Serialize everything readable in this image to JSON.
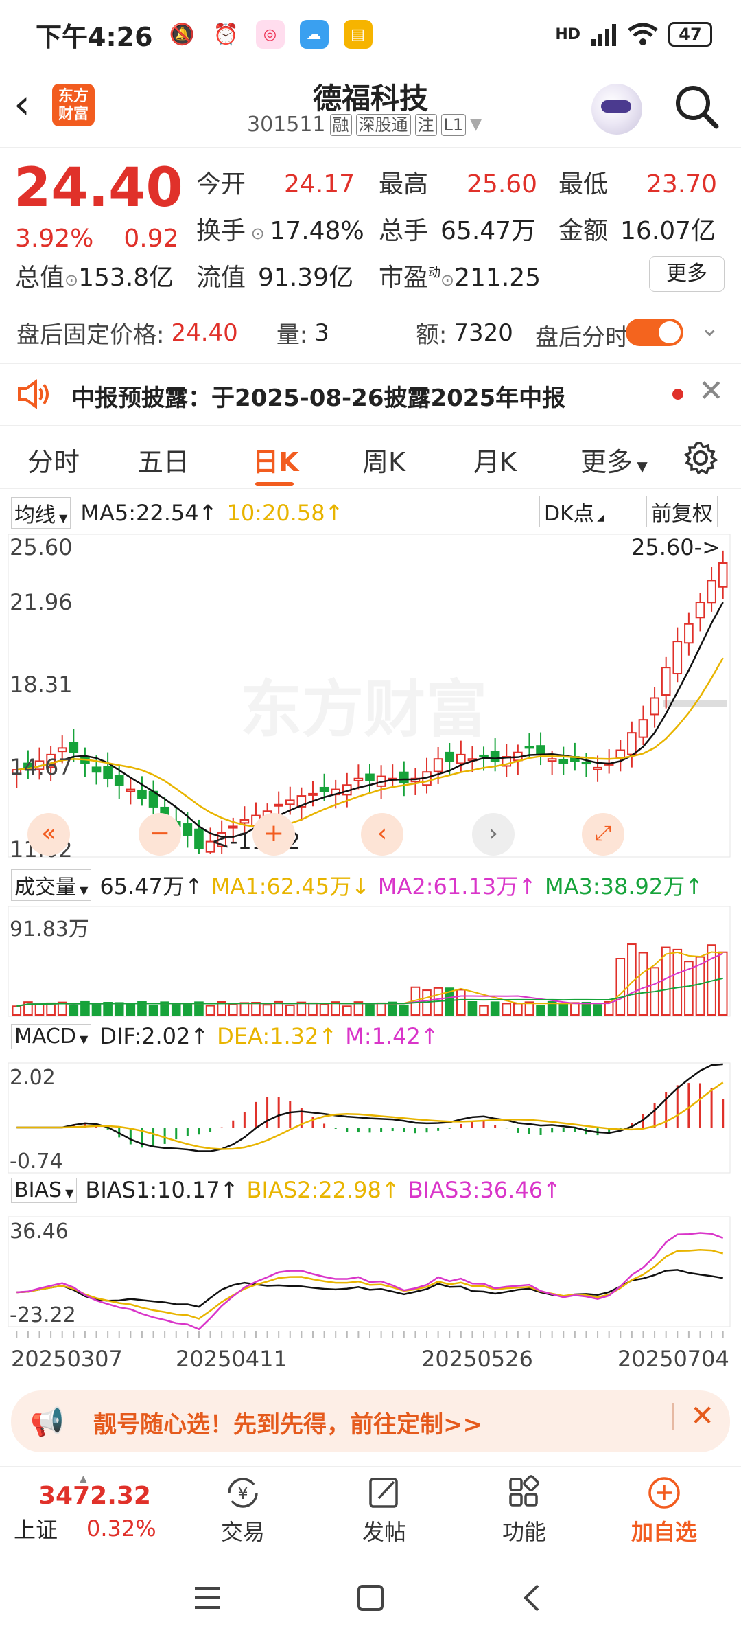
{
  "status": {
    "time": "下午4:26",
    "signal": "HD",
    "battery": "47"
  },
  "header": {
    "title": "德福科技",
    "code": "301511",
    "tags": [
      "融",
      "深股通",
      "注",
      "L1"
    ],
    "logo": "东方\n财富"
  },
  "quote": {
    "price": "24.40",
    "change_pct": "3.92%",
    "change": "0.92",
    "open_k": "今开",
    "open_v": "24.17",
    "high_k": "最高",
    "high_v": "25.60",
    "low_k": "最低",
    "low_v": "23.70",
    "turnover_k": "换手",
    "turnover_v": "17.48%",
    "vol_k": "总手",
    "vol_v": "65.47万",
    "amt_k": "金额",
    "amt_v": "16.07亿",
    "mcap_k": "总值",
    "mcap_v": "153.8亿",
    "float_k": "流值",
    "float_v": "91.39亿",
    "pe_k": "市盈",
    "pe_sup": "动",
    "pe_v": "211.25",
    "more_label": "更多"
  },
  "afterhours": {
    "label": "盘后固定价格:",
    "price": "24.40",
    "vol_label": "量:",
    "vol": "3",
    "amt_label": "额:",
    "amt": "7320",
    "toggle_label": "盘后分时"
  },
  "notice": {
    "text": "中报预披露：于2025-08-26披露2025年中报"
  },
  "tabs": [
    "分时",
    "五日",
    "日K",
    "周K",
    "月K",
    "更多"
  ],
  "kline": {
    "ma_selector": "均线",
    "ma5": "MA5:22.54↑",
    "ma10": "10:20.58↑",
    "dk_label": "DK点",
    "adjust_label": "前复权",
    "axis_labels": [
      "25.60",
      "21.96",
      "18.31",
      "14.67",
      "11.02"
    ],
    "high_marker": "25.60->",
    "low_marker": "<-11.02",
    "watermark": "东方财富"
  },
  "volume": {
    "selector": "成交量",
    "value": "65.47万↑",
    "ma1": "MA1:62.45万↓",
    "ma2": "MA2:61.13万↑",
    "ma3": "MA3:38.92万↑",
    "axis_top": "91.83万"
  },
  "macd": {
    "selector": "MACD",
    "dif": "DIF:2.02↑",
    "dea": "DEA:1.32↑",
    "m": "M:1.42↑",
    "axis_top": "2.02",
    "axis_bottom": "-0.74"
  },
  "bias": {
    "selector": "BIAS",
    "b1": "BIAS1:10.17↑",
    "b2": "BIAS2:22.98↑",
    "b3": "BIAS3:36.46↑",
    "axis_top": "36.46",
    "axis_bottom": "-23.22"
  },
  "dates": [
    "20250307",
    "20250411",
    "20250526",
    "20250704"
  ],
  "chart_data": {
    "type": "candlestick",
    "ylim": [
      11.02,
      25.6
    ],
    "high": 25.6,
    "low": 11.02,
    "close_trend": [
      14.9,
      15.0,
      15.3,
      15.6,
      15.9,
      15.7,
      15.2,
      14.8,
      14.5,
      14.2,
      14.0,
      13.6,
      13.2,
      12.8,
      12.3,
      11.9,
      11.3,
      11.6,
      12.0,
      12.3,
      12.6,
      12.8,
      13.0,
      13.3,
      13.5,
      13.7,
      13.8,
      13.9,
      14.0,
      14.2,
      14.5,
      14.4,
      14.6,
      14.5,
      14.3,
      14.5,
      14.8,
      15.4,
      15.3,
      15.6,
      15.4,
      15.5,
      15.3,
      15.5,
      15.7,
      15.9,
      15.6,
      15.4,
      15.2,
      15.3,
      15.2,
      15.0,
      15.2,
      15.8,
      16.6,
      17.2,
      18.2,
      19.6,
      20.8,
      21.6,
      22.6,
      23.6,
      24.4
    ]
  },
  "banner": {
    "text": "靓号随心选！先到先得，前往定制>>"
  },
  "bottomnav": {
    "index_value": "3472.32",
    "index_name": "上证",
    "index_pct": "0.32%",
    "trade": "交易",
    "post": "发帖",
    "func": "功能",
    "watch": "加自选"
  },
  "colors": {
    "accent": "#f25c1f",
    "up": "#e0312a",
    "down": "#16a33a"
  }
}
